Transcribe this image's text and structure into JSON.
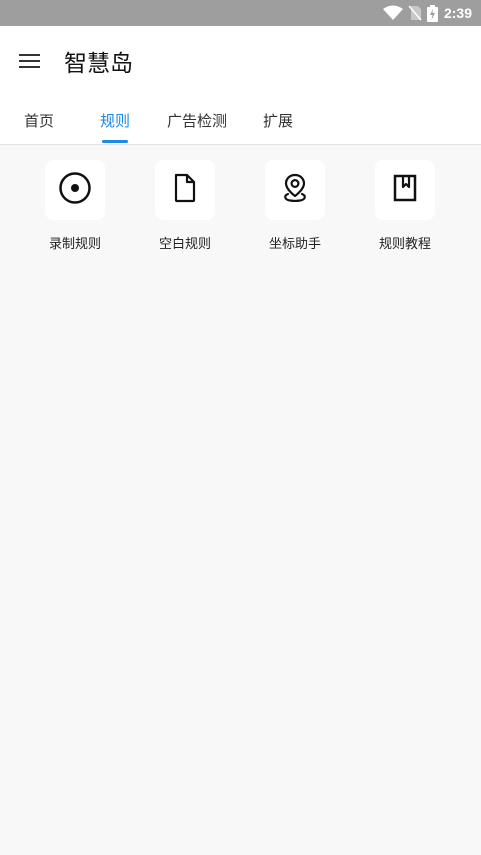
{
  "status_bar": {
    "time": "2:39",
    "icons": [
      "wifi-icon",
      "no-sim-icon",
      "battery-charging-icon"
    ]
  },
  "app_bar": {
    "title": "智慧岛",
    "menu_icon": "menu-icon"
  },
  "tabs": [
    {
      "label": "首页",
      "active": false
    },
    {
      "label": "规则",
      "active": true
    },
    {
      "label": "广告检测",
      "active": false
    },
    {
      "label": "扩展",
      "active": false
    }
  ],
  "tools": [
    {
      "label": "录制规则",
      "icon": "record-icon"
    },
    {
      "label": "空白规则",
      "icon": "blank-file-icon"
    },
    {
      "label": "坐标助手",
      "icon": "location-pin-icon"
    },
    {
      "label": "规则教程",
      "icon": "bookmark-book-icon"
    }
  ],
  "colors": {
    "accent": "#1e88e5",
    "status_bar": "#9e9e9e",
    "background": "#f8f8f8"
  }
}
